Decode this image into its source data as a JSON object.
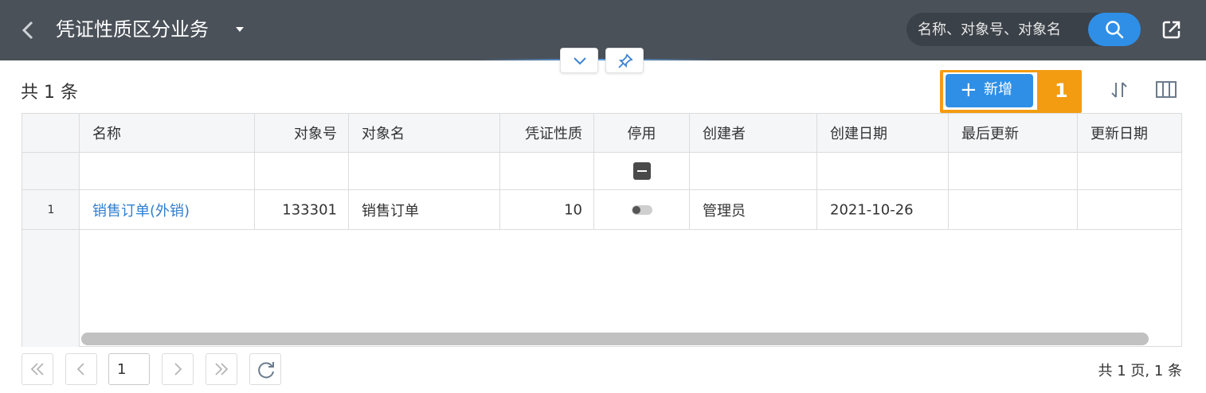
{
  "header": {
    "title": "凭证性质区分业务",
    "search_placeholder": "名称、对象号、对象名"
  },
  "toolbar": {
    "count_text": "共 1 条",
    "add_label": "新增",
    "highlight_number": "1"
  },
  "grid": {
    "columns": [
      "名称",
      "对象号",
      "对象名",
      "凭证性质",
      "停用",
      "创建者",
      "创建日期",
      "最后更新",
      "更新日期"
    ],
    "rows": [
      {
        "rownum": "1",
        "name": "销售订单(外销)",
        "object_no": "133301",
        "object_name": "销售订单",
        "voucher_type": "10",
        "disabled": false,
        "creator": "管理员",
        "created_date": "2021-10-26",
        "last_updated_by": "",
        "updated_date": ""
      }
    ]
  },
  "pagination": {
    "current_page": "1",
    "summary": "共 1 页, 1 条"
  },
  "colors": {
    "header_bg": "#4a5159",
    "primary": "#2f8fe6",
    "highlight": "#f39c12",
    "link": "#2f7fd0"
  },
  "icons": [
    "back-icon",
    "caret-down-icon",
    "search-icon",
    "export-icon",
    "chevron-down-icon",
    "pin-icon",
    "plus-icon",
    "sort-icon",
    "columns-icon",
    "first-page-icon",
    "prev-page-icon",
    "next-page-icon",
    "last-page-icon",
    "refresh-icon"
  ]
}
